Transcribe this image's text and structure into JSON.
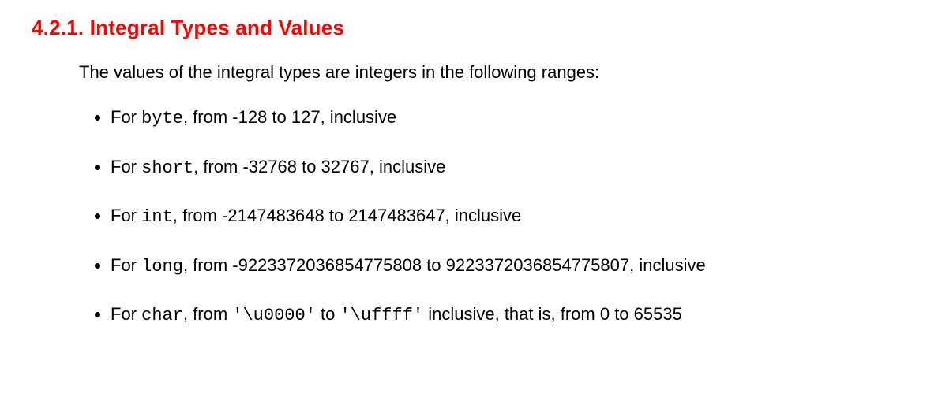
{
  "heading": "4.2.1. Integral Types and Values",
  "intro": "The values of the integral types are integers in the following ranges:",
  "items": [
    {
      "prefix": "For ",
      "type": "byte",
      "suffix": ", from -128 to 127, inclusive"
    },
    {
      "prefix": "For ",
      "type": "short",
      "suffix": ", from -32768 to 32767, inclusive"
    },
    {
      "prefix": "For ",
      "type": "int",
      "suffix": ", from -2147483648 to 2147483647, inclusive"
    },
    {
      "prefix": "For ",
      "type": "long",
      "suffix": ", from -9223372036854775808 to 9223372036854775807, inclusive"
    },
    {
      "prefix": "For ",
      "type": "char",
      "mid1": ", from ",
      "code1": "'\\u0000'",
      "mid2": " to ",
      "code2": "'\\uffff'",
      "suffix2": " inclusive, that is, from 0 to 65535"
    }
  ]
}
